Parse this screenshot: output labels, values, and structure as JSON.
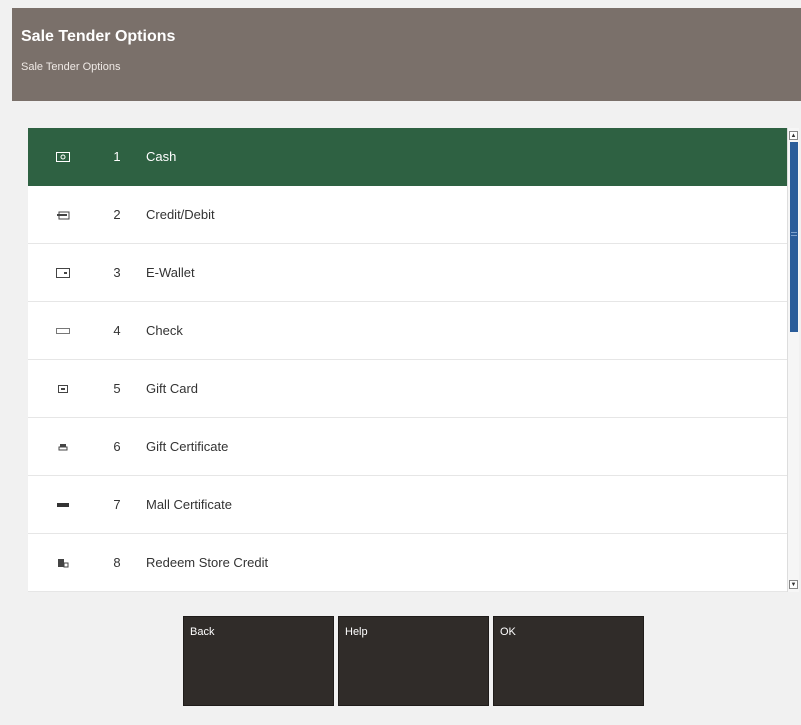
{
  "header": {
    "title": "Sale Tender Options",
    "subtitle": "Sale Tender Options"
  },
  "list": {
    "items": [
      {
        "number": "1",
        "label": "Cash",
        "icon": "cash-icon",
        "selected": true
      },
      {
        "number": "2",
        "label": "Credit/Debit",
        "icon": "credit-card-icon",
        "selected": false
      },
      {
        "number": "3",
        "label": "E-Wallet",
        "icon": "wallet-icon",
        "selected": false
      },
      {
        "number": "4",
        "label": "Check",
        "icon": "check-icon",
        "selected": false
      },
      {
        "number": "5",
        "label": "Gift Card",
        "icon": "gift-card-icon",
        "selected": false
      },
      {
        "number": "6",
        "label": "Gift Certificate",
        "icon": "gift-certificate-icon",
        "selected": false
      },
      {
        "number": "7",
        "label": "Mall Certificate",
        "icon": "mall-certificate-icon",
        "selected": false
      },
      {
        "number": "8",
        "label": "Redeem Store Credit",
        "icon": "store-credit-icon",
        "selected": false
      }
    ]
  },
  "buttons": {
    "back": "Back",
    "help": "Help",
    "ok": "OK"
  },
  "colors": {
    "header_bg": "#7a706a",
    "selected_row": "#2e6142",
    "button_bg": "#302c29",
    "scroll_thumb": "#2b5d9a"
  }
}
